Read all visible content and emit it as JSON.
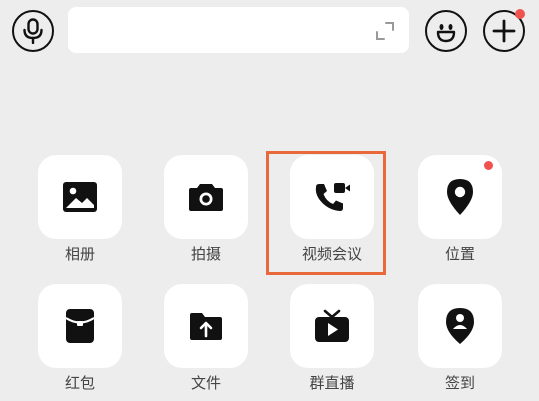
{
  "input_bar": {
    "voice_icon": "microphone-icon",
    "expand_icon": "expand-icon",
    "emoji_icon": "smiley-icon",
    "plus_icon": "plus-icon",
    "plus_has_badge": true
  },
  "accent": {
    "highlight_border": "#e8693a",
    "badge": "#f0524f",
    "tile_background": "#ffffff",
    "panel_background": "#ededed"
  },
  "panel": {
    "items": [
      {
        "label": "相册",
        "icon": "image-icon",
        "badge": false
      },
      {
        "label": "拍摄",
        "icon": "camera-icon",
        "badge": false
      },
      {
        "label": "视频会议",
        "icon": "video-call-icon",
        "badge": false,
        "highlighted": true
      },
      {
        "label": "位置",
        "icon": "location-pin-icon",
        "badge": true
      },
      {
        "label": "红包",
        "icon": "red-packet-icon",
        "badge": false
      },
      {
        "label": "文件",
        "icon": "file-upload-icon",
        "badge": false
      },
      {
        "label": "群直播",
        "icon": "live-tv-icon",
        "badge": false
      },
      {
        "label": "签到",
        "icon": "check-in-icon",
        "badge": false
      }
    ]
  }
}
